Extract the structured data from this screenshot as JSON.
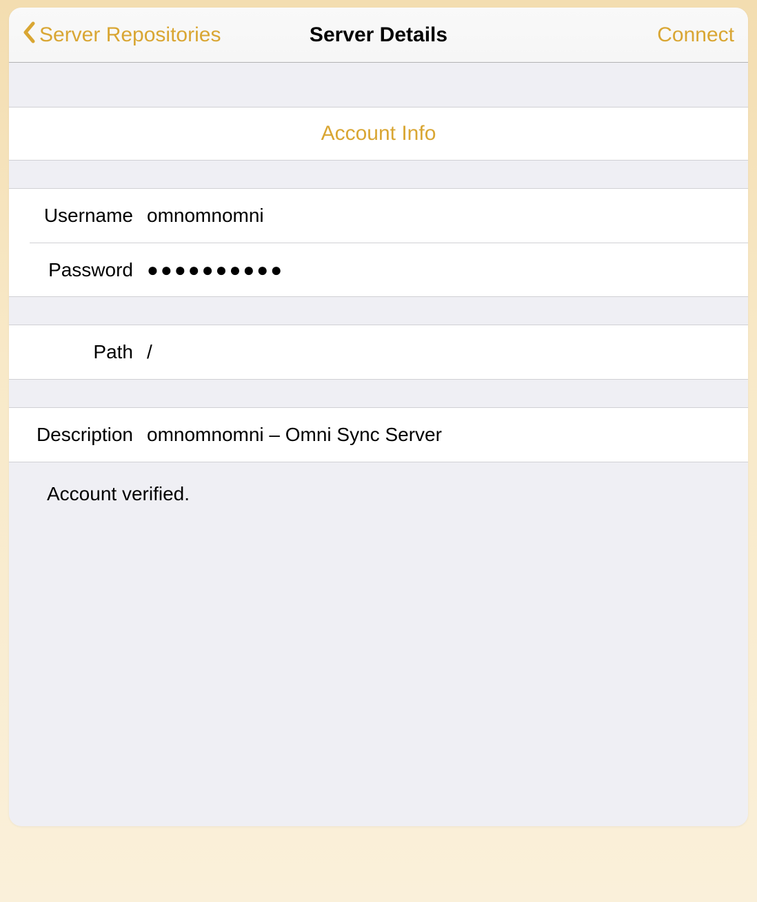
{
  "navbar": {
    "back_label": "Server Repositories",
    "title": "Server Details",
    "connect_label": "Connect"
  },
  "sections": {
    "account_info_label": "Account Info"
  },
  "fields": {
    "username": {
      "label": "Username",
      "value": "omnomnomni"
    },
    "password": {
      "label": "Password",
      "value": "●●●●●●●●●●"
    },
    "path": {
      "label": "Path",
      "value": "/"
    },
    "description": {
      "label": "Description",
      "value": "omnomnomni – Omni Sync Server"
    }
  },
  "status": {
    "message": "Account verified."
  }
}
